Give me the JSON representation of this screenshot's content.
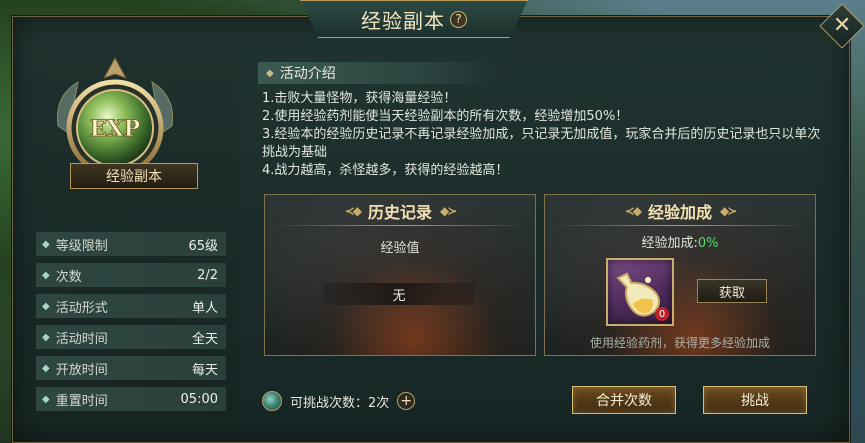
{
  "window": {
    "title": "经验副本",
    "help_icon": "question-mark-icon",
    "close_icon": "close-x-icon"
  },
  "emblem": {
    "text": "EXP",
    "name": "经验副本"
  },
  "stats": [
    {
      "label": "等级限制",
      "value": "65级"
    },
    {
      "label": "次数",
      "value": "2/2"
    },
    {
      "label": "活动形式",
      "value": "单人"
    },
    {
      "label": "活动时间",
      "value": "全天"
    },
    {
      "label": "开放时间",
      "value": "每天"
    },
    {
      "label": "重置时间",
      "value": "05:00"
    }
  ],
  "intro": {
    "tab_label": "活动介绍",
    "lines": [
      "1.击败大量怪物，获得海量经验！",
      "2.使用经验药剂能使当天经验副本的所有次数，经验增加50%！",
      "3.经验本的经验历史记录不再记录经验加成，只记录无加成值，玩家合并后的历史记录也只以单次挑战为基础",
      "4.战力越高，杀怪越多，获得的经验越高！"
    ]
  },
  "history": {
    "title": "历史记录",
    "label": "经验值",
    "value": "无"
  },
  "bonus": {
    "title": "经验加成",
    "label": "经验加成:",
    "percent": "0%",
    "potion_count": "0",
    "get_button": "获取",
    "hint": "使用经验药剂，获得更多经验加成"
  },
  "footer": {
    "challenges_label": "可挑战次数：",
    "challenges_value": "2次",
    "merge_button": "合并次数",
    "challenge_button": "挑战"
  }
}
